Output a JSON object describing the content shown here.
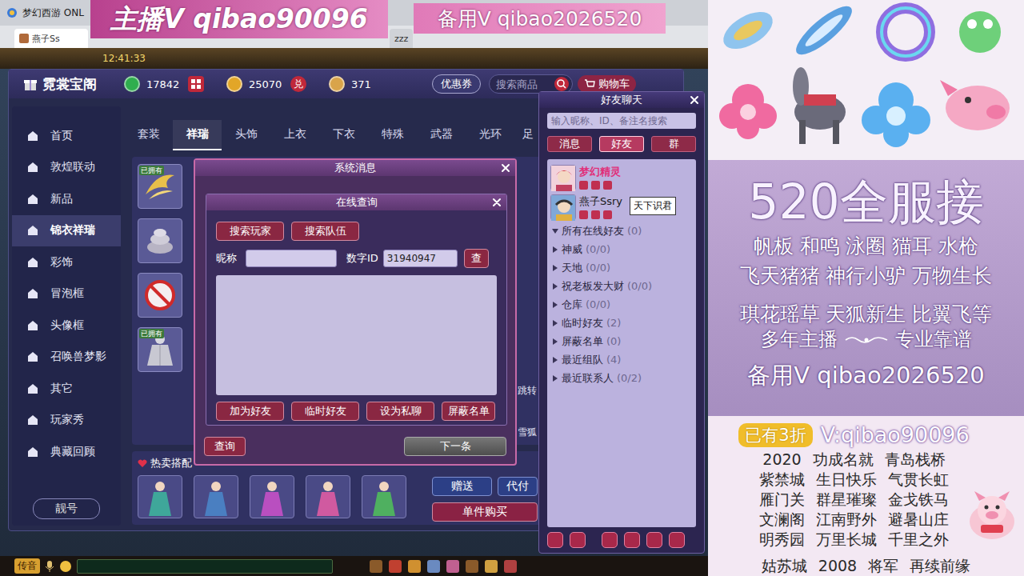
{
  "stream_overlay": {
    "main_contact": "主播V qibao90096",
    "backup_contact": "备用V qibao2026520"
  },
  "client": {
    "title": "梦幻西游 ONL",
    "tabs": [
      {
        "label": "燕子Ss",
        "selected": true
      },
      {
        "label": "zzz",
        "selected": false
      }
    ]
  },
  "game": {
    "clock": "12:41:33"
  },
  "shop": {
    "title": "霓裳宝阁",
    "currencies": [
      {
        "value": "17842",
        "color": "#2fae4e",
        "kind": "grid"
      },
      {
        "value": "25070",
        "color": "#e2a628",
        "kind": "exchange",
        "badge": "兑"
      },
      {
        "value": "371",
        "color": "#d9a44a",
        "kind": "plain"
      }
    ],
    "coupon_button": "优惠券",
    "search_placeholder": "搜索商品",
    "cart_button": "购物车",
    "sidebar": [
      {
        "label": "首页",
        "selected": false
      },
      {
        "label": "敦煌联动",
        "selected": false
      },
      {
        "label": "新品",
        "selected": false
      },
      {
        "label": "锦衣祥瑞",
        "selected": true
      },
      {
        "label": "彩饰",
        "selected": false
      },
      {
        "label": "冒泡框",
        "selected": false
      },
      {
        "label": "头像框",
        "selected": false
      },
      {
        "label": "召唤兽梦影",
        "selected": false
      },
      {
        "label": "其它",
        "selected": false
      },
      {
        "label": "玩家秀",
        "selected": false
      },
      {
        "label": "典藏回顾",
        "selected": false
      }
    ],
    "vip_button": "靓号",
    "category_tabs": [
      {
        "label": "套装",
        "selected": false
      },
      {
        "label": "祥瑞",
        "selected": true
      },
      {
        "label": "头饰",
        "selected": false
      },
      {
        "label": "上衣",
        "selected": false
      },
      {
        "label": "下衣",
        "selected": false
      },
      {
        "label": "特殊",
        "selected": false
      },
      {
        "label": "武器",
        "selected": false
      },
      {
        "label": "光环",
        "selected": false
      },
      {
        "label": "足",
        "selected": false
      }
    ],
    "items": [
      {
        "kind": "wings",
        "owned": true
      },
      {
        "kind": "stone",
        "owned": false
      },
      {
        "kind": "forbidden",
        "owned": false
      },
      {
        "kind": "cloak",
        "owned": true
      }
    ],
    "owned_label": "已拥有",
    "side_labels": [
      "跳转",
      "雪狐"
    ],
    "bundle": {
      "title": "热卖搭配",
      "figures": [
        {
          "color": "#3fa79a"
        },
        {
          "color": "#4a7fc1"
        },
        {
          "color": "#b94fc0"
        },
        {
          "color": "#d05aa0"
        },
        {
          "color": "#4fb060"
        }
      ]
    },
    "actions": {
      "gift": "赠送",
      "pay_for": "代付",
      "buy_single": "单件购买"
    }
  },
  "system_dialog": {
    "title": "系统消息",
    "query_button": "查询",
    "next_button": "下一条",
    "online_query": {
      "title": "在线查询",
      "mode_buttons": [
        "搜索玩家",
        "搜索队伍"
      ],
      "nickname_label": "昵称",
      "id_label": "数字ID",
      "id_value": "31940947",
      "search_button": "查",
      "actions": [
        "加为好友",
        "临时好友",
        "设为私聊",
        "屏蔽名单"
      ]
    }
  },
  "friends_panel": {
    "title": "好友聊天",
    "search_placeholder": "输入昵称、ID、备注名搜索",
    "tabs": [
      {
        "label": "消息",
        "selected": false
      },
      {
        "label": "好友",
        "selected": true
      },
      {
        "label": "群",
        "selected": false
      }
    ],
    "friends": [
      {
        "name": "梦幻精灵",
        "color": "#e0307a"
      },
      {
        "name": "燕子Ssry",
        "color": "#1a1a1a"
      }
    ],
    "tooltip": "天下识君",
    "groups": [
      {
        "label": "所有在线好友",
        "count": "(0)",
        "expanded": true
      },
      {
        "label": "神威",
        "count": "(0/0)",
        "expanded": false
      },
      {
        "label": "天地",
        "count": "(0/0)",
        "expanded": false
      },
      {
        "label": "祝老板发大财",
        "count": "(0/0)",
        "expanded": false
      },
      {
        "label": "仓库",
        "count": "(0/0)",
        "expanded": false
      },
      {
        "label": "临时好友",
        "count": "(2)",
        "expanded": false
      },
      {
        "label": "屏蔽名单",
        "count": "(0)",
        "expanded": false
      },
      {
        "label": "最近组队",
        "count": "(4)",
        "expanded": false
      },
      {
        "label": "最近联系人",
        "count": "(0/2)",
        "expanded": false
      }
    ]
  },
  "ad_panel": {
    "headline": "520全服接",
    "lines": [
      "帆板 和鸣 泳圈 猫耳 水枪",
      "飞天猪猪 神行小驴 万物生长",
      "琪花瑶草 天狐新生 比翼飞等"
    ],
    "slogan": [
      "多年主播",
      "专业靠谱"
    ],
    "backup": "备用V qibao2026520",
    "discount_badge": "已有3折",
    "contact": "V:qibao90096",
    "grid": [
      [
        "2020",
        "功成名就",
        "青岛栈桥"
      ],
      [
        "紫禁城",
        "生日快乐",
        "气贯长虹"
      ],
      [
        "雁门关",
        "群星璀璨",
        "金戈铁马"
      ],
      [
        "文澜阁",
        "江南野外",
        "避暑山庄"
      ],
      [
        "明秀园",
        "万里长城",
        "千里之外"
      ],
      [
        "姑苏城",
        "2008",
        "将军",
        "再续前缘"
      ]
    ]
  },
  "bottom_bar": {
    "voice_button": "传音"
  }
}
